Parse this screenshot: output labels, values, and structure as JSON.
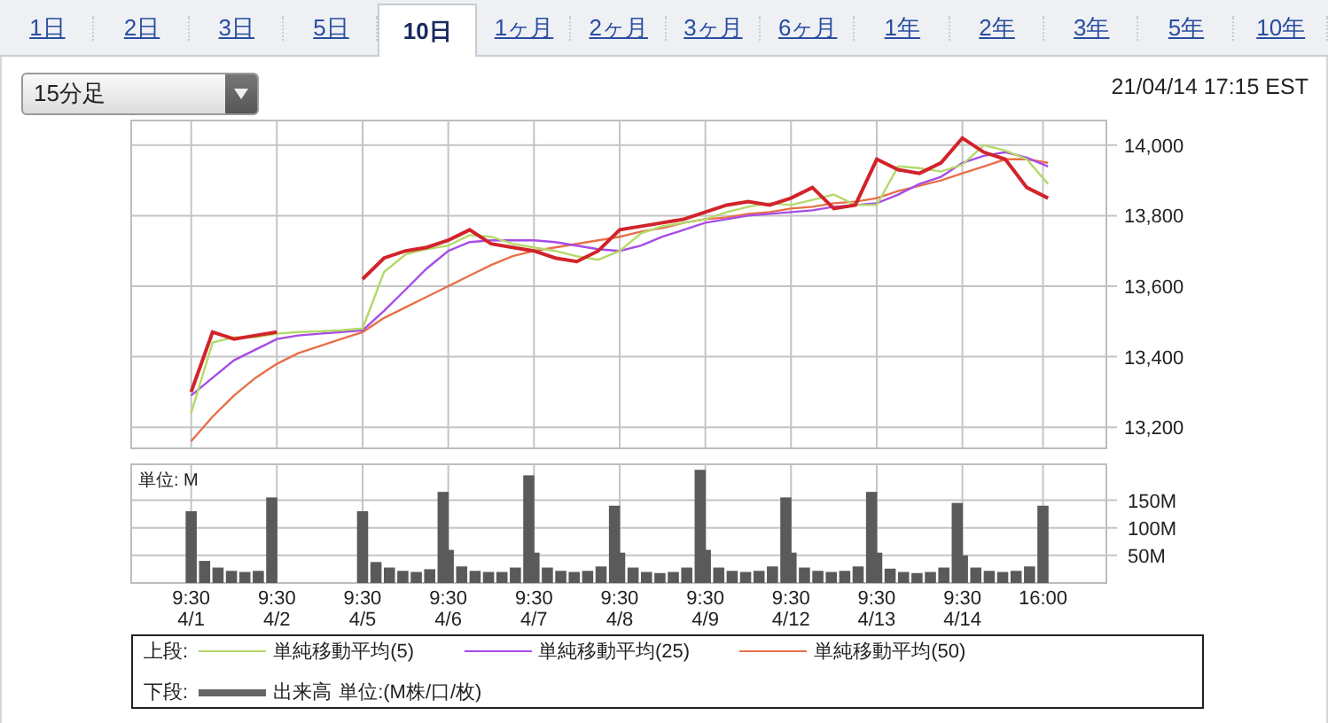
{
  "tabs": [
    {
      "label": "1日",
      "selected": false
    },
    {
      "label": "2日",
      "selected": false
    },
    {
      "label": "3日",
      "selected": false
    },
    {
      "label": "5日",
      "selected": false
    },
    {
      "label": "10日",
      "selected": true
    },
    {
      "label": "1ヶ月",
      "selected": false
    },
    {
      "label": "2ヶ月",
      "selected": false
    },
    {
      "label": "3ヶ月",
      "selected": false
    },
    {
      "label": "6ヶ月",
      "selected": false
    },
    {
      "label": "1年",
      "selected": false
    },
    {
      "label": "2年",
      "selected": false
    },
    {
      "label": "3年",
      "selected": false
    },
    {
      "label": "5年",
      "selected": false
    },
    {
      "label": "10年",
      "selected": false
    }
  ],
  "interval_select": {
    "value": "15分足"
  },
  "timestamp": "21/04/14 17:15 EST",
  "price_chart": {
    "chart_data": {
      "type": "line",
      "grid": true,
      "ylim": [
        13140,
        14070
      ],
      "yticks": [
        {
          "value": 13200,
          "label": "13,200"
        },
        {
          "value": 13400,
          "label": "13,400"
        },
        {
          "value": 13600,
          "label": "13,600"
        },
        {
          "value": 13800,
          "label": "13,800"
        },
        {
          "value": 14000,
          "label": "14,000"
        }
      ],
      "categories": [
        null,
        null,
        null,
        null,
        null,
        null,
        null,
        null,
        null,
        null,
        null,
        null,
        null,
        null,
        null,
        null,
        null,
        null,
        null,
        null,
        null,
        null,
        null,
        null,
        null,
        null,
        null,
        null,
        null,
        null,
        null,
        null,
        null,
        null,
        null,
        null,
        null,
        null,
        null,
        null,
        null
      ],
      "series": [
        {
          "color": "#d2232a",
          "values": [
            13300,
            13470,
            13450,
            13460,
            13470,
            null,
            null,
            null,
            13620,
            13680,
            13700,
            13710,
            13730,
            13760,
            13720,
            13710,
            13700,
            13680,
            13670,
            13700,
            13760,
            13770,
            13780,
            13790,
            13810,
            13830,
            13840,
            13830,
            13850,
            13880,
            13820,
            13830,
            13960,
            13930,
            13920,
            13950,
            14020,
            13980,
            13960,
            13880,
            13850
          ]
        },
        {
          "name": "単純移動平均(5)",
          "color": "#b5d96a",
          "values": [
            13240,
            13440,
            13455,
            13455,
            13465,
            13470,
            13472,
            13475,
            13480,
            13640,
            13690,
            13705,
            13715,
            13745,
            13740,
            13720,
            13710,
            13700,
            13685,
            13675,
            13700,
            13750,
            13770,
            13780,
            13790,
            13810,
            13825,
            13835,
            13830,
            13845,
            13860,
            13830,
            13830,
            13940,
            13935,
            13925,
            13945,
            14000,
            13985,
            13960,
            13890
          ]
        },
        {
          "name": "単純移動平均(25)",
          "color": "#a64ce6",
          "values": [
            13290,
            13340,
            13390,
            13420,
            13450,
            13460,
            13465,
            13470,
            13475,
            13530,
            13590,
            13650,
            13700,
            13725,
            13730,
            13730,
            13730,
            13725,
            13715,
            13705,
            13700,
            13715,
            13740,
            13760,
            13780,
            13790,
            13800,
            13805,
            13810,
            13815,
            13825,
            13830,
            13835,
            13860,
            13890,
            13910,
            13950,
            13970,
            13980,
            13965,
            13940
          ]
        },
        {
          "name": "単純移動平均(50)",
          "color": "#e8704a",
          "values": [
            13160,
            13230,
            13290,
            13340,
            13380,
            13410,
            13430,
            13450,
            13470,
            13510,
            13540,
            13570,
            13600,
            13630,
            13660,
            13685,
            13700,
            13710,
            13720,
            13730,
            13740,
            13755,
            13765,
            13780,
            13790,
            13795,
            13805,
            13810,
            13820,
            13825,
            13835,
            13840,
            13850,
            13870,
            13885,
            13900,
            13920,
            13940,
            13960,
            13960,
            13950
          ]
        }
      ]
    }
  },
  "volume_chart": {
    "chart_data": {
      "type": "bar",
      "grid": true,
      "ylabel": "単位: M",
      "ylim": [
        0,
        215
      ],
      "yticks": [
        {
          "value": 50,
          "label": "50M"
        },
        {
          "value": 100,
          "label": "100M"
        },
        {
          "value": 150,
          "label": "150M"
        }
      ],
      "categories": [
        "9:30 4/1",
        null,
        null,
        null,
        null,
        null,
        null,
        "9:30 4/2",
        null,
        null,
        null,
        null,
        null,
        null,
        "9:30 4/5",
        null,
        null,
        null,
        null,
        null,
        null,
        "9:30 4/6",
        null,
        null,
        null,
        null,
        null,
        null,
        "9:30 4/7",
        null,
        null,
        null,
        null,
        null,
        null,
        "9:30 4/8",
        null,
        null,
        null,
        null,
        null,
        null,
        "9:30 4/9",
        null,
        null,
        null,
        null,
        null,
        null,
        "9:30 4/12",
        null,
        null,
        null,
        null,
        null,
        null,
        "9:30 4/13",
        null,
        null,
        null,
        null,
        null,
        null,
        "9:30 4/14",
        null,
        null,
        null,
        null,
        null,
        "16:00"
      ],
      "series": [
        {
          "name": "出来高",
          "color": "#5a5a5a",
          "values": [
            130,
            40,
            28,
            22,
            20,
            22,
            155,
            null,
            null,
            null,
            null,
            null,
            null,
            null,
            130,
            38,
            28,
            22,
            20,
            25,
            165,
            60,
            30,
            22,
            20,
            20,
            28,
            195,
            55,
            28,
            22,
            20,
            22,
            30,
            140,
            55,
            28,
            20,
            18,
            20,
            28,
            205,
            60,
            28,
            22,
            20,
            22,
            30,
            155,
            55,
            28,
            22,
            20,
            22,
            30,
            165,
            55,
            26,
            20,
            18,
            20,
            28,
            145,
            50,
            28,
            22,
            20,
            22,
            30,
            140
          ]
        }
      ]
    }
  },
  "legend": {
    "upper_label": "上段:",
    "lower_label": "下段:",
    "lower_item": {
      "label": "単位:(M株/口/枚)",
      "color": "#666666"
    }
  }
}
